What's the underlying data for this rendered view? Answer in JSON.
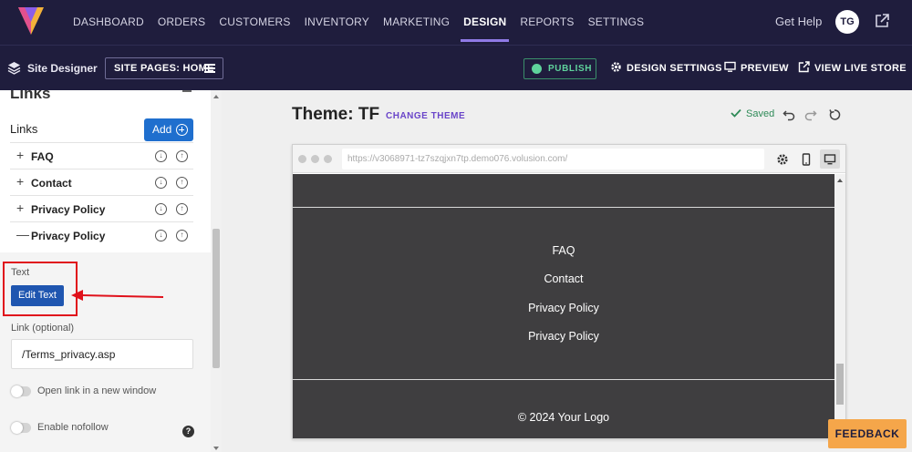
{
  "topnav": {
    "items": [
      "DASHBOARD",
      "ORDERS",
      "CUSTOMERS",
      "INVENTORY",
      "MARKETING",
      "DESIGN",
      "REPORTS",
      "SETTINGS"
    ],
    "active": "DESIGN",
    "get_help": "Get Help",
    "avatar_initials": "TG"
  },
  "subnav": {
    "title": "Site Designer",
    "site_pages": "SITE PAGES: HOME",
    "publish": "PUBLISH",
    "design_settings": "DESIGN SETTINGS",
    "preview": "PREVIEW",
    "view_live_store": "VIEW LIVE STORE"
  },
  "panel": {
    "header": "Links",
    "links_label": "Links",
    "add_label": "Add",
    "items": [
      {
        "sign": "+",
        "label": "FAQ"
      },
      {
        "sign": "+",
        "label": "Contact"
      },
      {
        "sign": "+",
        "label": "Privacy Policy"
      },
      {
        "sign": "—",
        "label": "Privacy Policy"
      }
    ],
    "text_label": "Text",
    "edit_text": "Edit Text",
    "link_label": "Link (optional)",
    "link_value": "/Terms_privacy.asp",
    "open_new_window": "Open link in a new window",
    "nofollow": "Enable nofollow",
    "help": "?"
  },
  "canvas": {
    "theme_title": "Theme: TF",
    "change_theme": "CHANGE THEME",
    "saved": "Saved",
    "url": "https://v3068971-tz7szqjxn7tp.demo076.volusion.com/",
    "footer_links": [
      "FAQ",
      "Contact",
      "Privacy Policy",
      "Privacy Policy"
    ],
    "copyright": "© 2024 Your Logo"
  },
  "feedback": "FEEDBACK",
  "colors": {
    "nav_bg": "#1f1d3d",
    "accent": "#8f7ae6",
    "primary_button": "#1f56b0",
    "highlight": "#e0111b",
    "site_bg": "#3f3e40",
    "feedback": "#f5a64a",
    "publish": "#5fd39c"
  },
  "icons": [
    "logo-icon",
    "external-link-icon",
    "layers-icon",
    "hamburger-icon",
    "publish-icon",
    "gear-icon",
    "monitor-icon",
    "external-link-icon",
    "plus-circle-icon",
    "arrow-down-circle-icon",
    "arrow-up-circle-icon",
    "question-icon",
    "check-icon",
    "undo-icon",
    "redo-icon",
    "refresh-icon",
    "mobile-icon"
  ]
}
